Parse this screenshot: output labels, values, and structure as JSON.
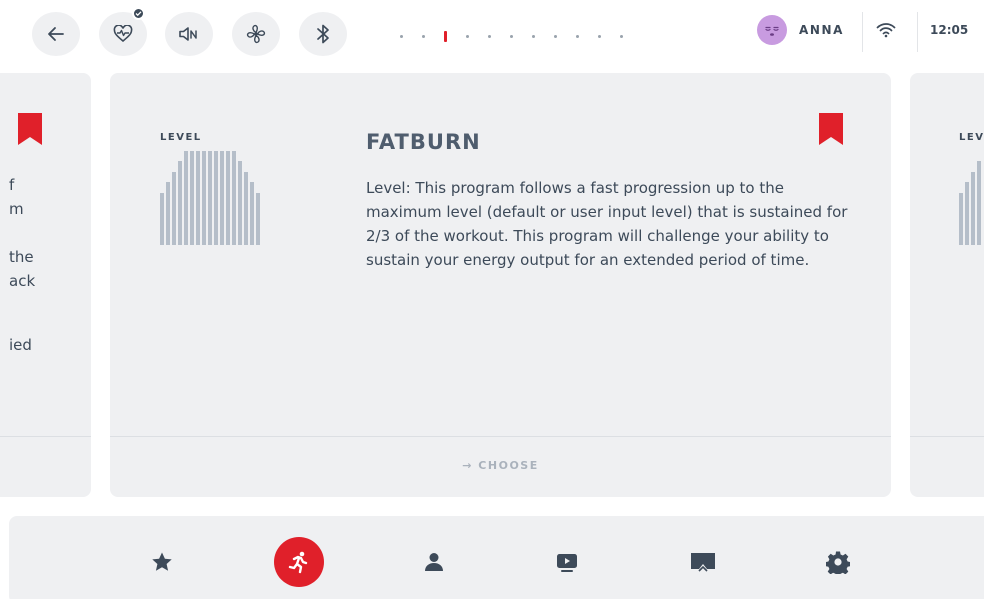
{
  "topbar": {
    "icons": [
      "back-arrow-icon",
      "heart-rate-icon",
      "sound-off-icon",
      "fan-icon",
      "bluetooth-icon"
    ],
    "pagination": {
      "total": 11,
      "active_index": 2
    },
    "user": {
      "name": "ANNA",
      "avatar": "sleepy-face-avatar"
    },
    "clock": "12:05"
  },
  "program": {
    "level_label": "LEVEL",
    "title": "FATBURN",
    "description": "Level: This program follows a fast progression up to the maximum level (default or user input level) that is sustained for 2/3 of the workout. This program will challenge your ability to sustain your energy output for an extended period of time.",
    "choose_label": "→ CHOOSE",
    "profile_levels": [
      5,
      6,
      7,
      8,
      9,
      9,
      9,
      9,
      9,
      9,
      9,
      9,
      9,
      8,
      7,
      6,
      5
    ]
  },
  "prev_card": {
    "fragments": [
      "f",
      "m",
      "the",
      "ack",
      "ied"
    ]
  },
  "next_card": {
    "level_label": "LEV",
    "profile_levels": [
      5,
      6,
      7,
      8
    ]
  },
  "nav": {
    "items": [
      "favorites-star-icon",
      "programs-runner-icon",
      "user-profile-icon",
      "video-play-icon",
      "screen-mirror-icon",
      "settings-gear-icon"
    ],
    "active_index": 1
  },
  "colors": {
    "accent": "#e0202a",
    "card_bg": "#eff0f2",
    "bar": "#b5bec9",
    "text": "#3d4a59"
  }
}
